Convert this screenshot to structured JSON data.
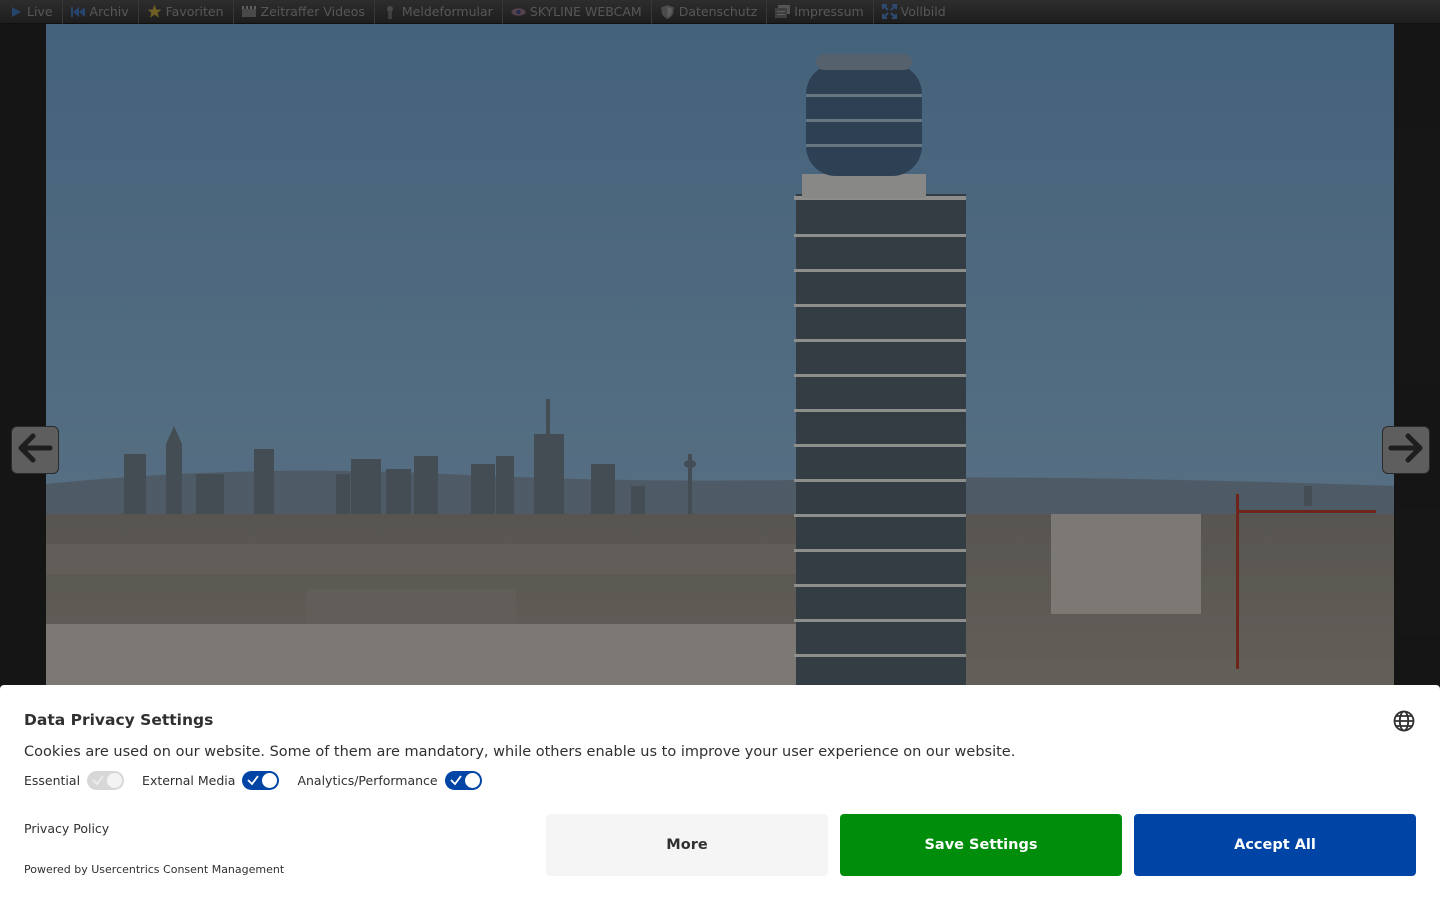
{
  "nav": {
    "items": [
      {
        "label": "Live",
        "icon": "play-icon"
      },
      {
        "label": "Archiv",
        "icon": "rewind-icon"
      },
      {
        "label": "Favoriten",
        "icon": "star-icon"
      },
      {
        "label": "Zeitraffer Videos",
        "icon": "film-icon"
      },
      {
        "label": "Meldeformular",
        "icon": "person-icon"
      },
      {
        "label": "SKYLINE WEBCAM",
        "icon": "eye-icon"
      },
      {
        "label": "Datenschutz",
        "icon": "shield-icon"
      },
      {
        "label": "Impressum",
        "icon": "documents-icon"
      },
      {
        "label": "Vollbild",
        "icon": "fullscreen-icon"
      }
    ]
  },
  "consent": {
    "title": "Data Privacy Settings",
    "description": "Cookies are used on our website. Some of them are mandatory, while others enable us to improve your user experience on our website.",
    "toggles": [
      {
        "label": "Essential",
        "on": true,
        "disabled": true
      },
      {
        "label": "External Media",
        "on": true,
        "disabled": false
      },
      {
        "label": "Analytics/Performance",
        "on": true,
        "disabled": false
      }
    ],
    "privacy_policy": "Privacy Policy",
    "powered_by": "Powered by Usercentrics Consent Management",
    "buttons": {
      "more": "More",
      "save": "Save Settings",
      "accept": "Accept All"
    }
  },
  "colors": {
    "accent_blue": "#0045a5",
    "save_green": "#008d0b",
    "nav_text": "#8d8d8d"
  }
}
